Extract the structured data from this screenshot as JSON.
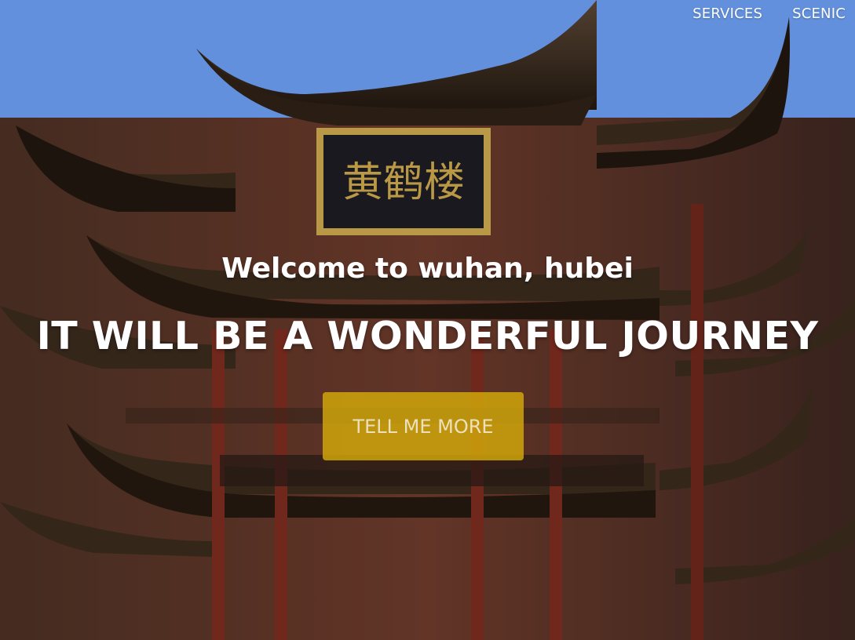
{
  "nav": {
    "items": [
      {
        "label": "SERVICES"
      },
      {
        "label": "SCENIC"
      }
    ]
  },
  "hero": {
    "lead": "Welcome to wuhan, hubei",
    "headline": "IT WILL BE A WONDERFUL JOURNEY",
    "button_label": "TELL ME MORE",
    "plaque_text": "黄鹤楼",
    "background_subject": "pagoda-photo"
  },
  "colors": {
    "sky": "#6a9cf0",
    "roof": "#3a2a1d",
    "pillar": "#7a2b1f",
    "gold": "#c9a74b",
    "button": "#d4aa0a"
  }
}
